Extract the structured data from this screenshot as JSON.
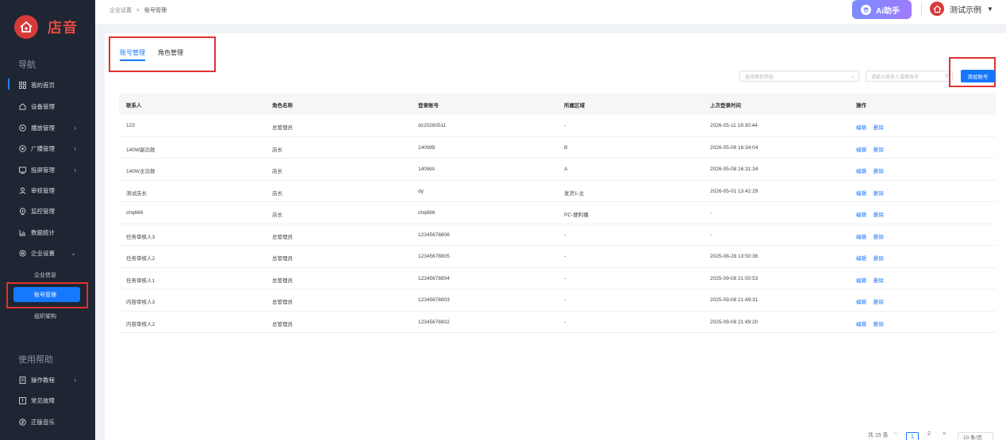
{
  "brand": {
    "name": "店音"
  },
  "sidebar": {
    "nav_heading": "导航",
    "items": [
      {
        "label": "我的首页",
        "icon": "grid-icon"
      },
      {
        "label": "设备管理",
        "icon": "device-icon"
      },
      {
        "label": "播放管理",
        "icon": "play-icon"
      },
      {
        "label": "广播管理",
        "icon": "broadcast-icon"
      },
      {
        "label": "投屏管理",
        "icon": "screen-cast-icon"
      },
      {
        "label": "审核管理",
        "icon": "audit-icon"
      },
      {
        "label": "监控管理",
        "icon": "monitor-icon"
      },
      {
        "label": "数据统计",
        "icon": "chart-icon"
      },
      {
        "label": "企业设置",
        "icon": "settings-icon"
      }
    ],
    "sub_items": [
      {
        "label": "企业信息"
      },
      {
        "label": "账号管理"
      },
      {
        "label": "组织架构"
      }
    ],
    "help_heading": "使用帮助",
    "help_items": [
      {
        "label": "操作教程",
        "icon": "tutorial-icon"
      },
      {
        "label": "常见故障",
        "icon": "fault-icon"
      },
      {
        "label": "正版音乐",
        "icon": "music-icon"
      }
    ]
  },
  "topbar": {
    "breadcrumb_parent": "企业设置",
    "breadcrumb_sep": ">",
    "breadcrumb_current": "账号管理",
    "ai_label": "Ai助手",
    "user_name": "测试示例"
  },
  "tabs": [
    {
      "label": "账号管理",
      "active": true
    },
    {
      "label": "角色管理",
      "active": false
    }
  ],
  "filters": {
    "role_placeholder": "选择角色筛选",
    "search_placeholder": "请输入联系人或者账号",
    "add_label": "添加账号"
  },
  "table": {
    "columns": [
      "联系人",
      "角色名称",
      "登录账号",
      "所属区域",
      "上次登录时间",
      "操作"
    ],
    "edit_label": "编辑",
    "delete_label": "删除",
    "rows": [
      {
        "contact": "123",
        "role": "总管理员",
        "account": "dz20260511",
        "region": "-",
        "last_login": "2026-05-11 18:30:44"
      },
      {
        "contact": "140W副功放",
        "role": "店长",
        "account": "140WB",
        "region": "B",
        "last_login": "2026-05-08 16:34:04"
      },
      {
        "contact": "140W主功放",
        "role": "店长",
        "account": "140WA",
        "region": "A",
        "last_login": "2026-05-08 16:31:34"
      },
      {
        "contact": "测试店长",
        "role": "店长",
        "account": "dy",
        "region": "发货1-主",
        "last_login": "2026-05-01 13:42:29"
      },
      {
        "contact": "chq666",
        "role": "店长",
        "account": "chq666",
        "region": "PC-便利播",
        "last_login": "-"
      },
      {
        "contact": "任务审核人3",
        "role": "总管理员",
        "account": "12345678806",
        "region": "-",
        "last_login": "-"
      },
      {
        "contact": "任务审核人2",
        "role": "总管理员",
        "account": "12345678805",
        "region": "-",
        "last_login": "2025-08-28 13:50:36"
      },
      {
        "contact": "任务审核人1",
        "role": "总管理员",
        "account": "12345678804",
        "region": "-",
        "last_login": "2025-09-08 21:50:53"
      },
      {
        "contact": "内容审核人3",
        "role": "总管理员",
        "account": "12345678803",
        "region": "-",
        "last_login": "2025-09-08 21:49:31"
      },
      {
        "contact": "内容审核人2",
        "role": "总管理员",
        "account": "12345678802",
        "region": "-",
        "last_login": "2025-09-08 21:49:20"
      }
    ]
  },
  "pagination": {
    "total": "共 15 条",
    "prev": "<",
    "current_page": "1",
    "next_page": "2",
    "next": ">",
    "page_size": "10 条/页"
  },
  "colors": {
    "accent": "#1677ff",
    "brand_red": "#d83a3a",
    "sidebar_bg": "#1f2633",
    "highlight_box": "#e03131"
  }
}
